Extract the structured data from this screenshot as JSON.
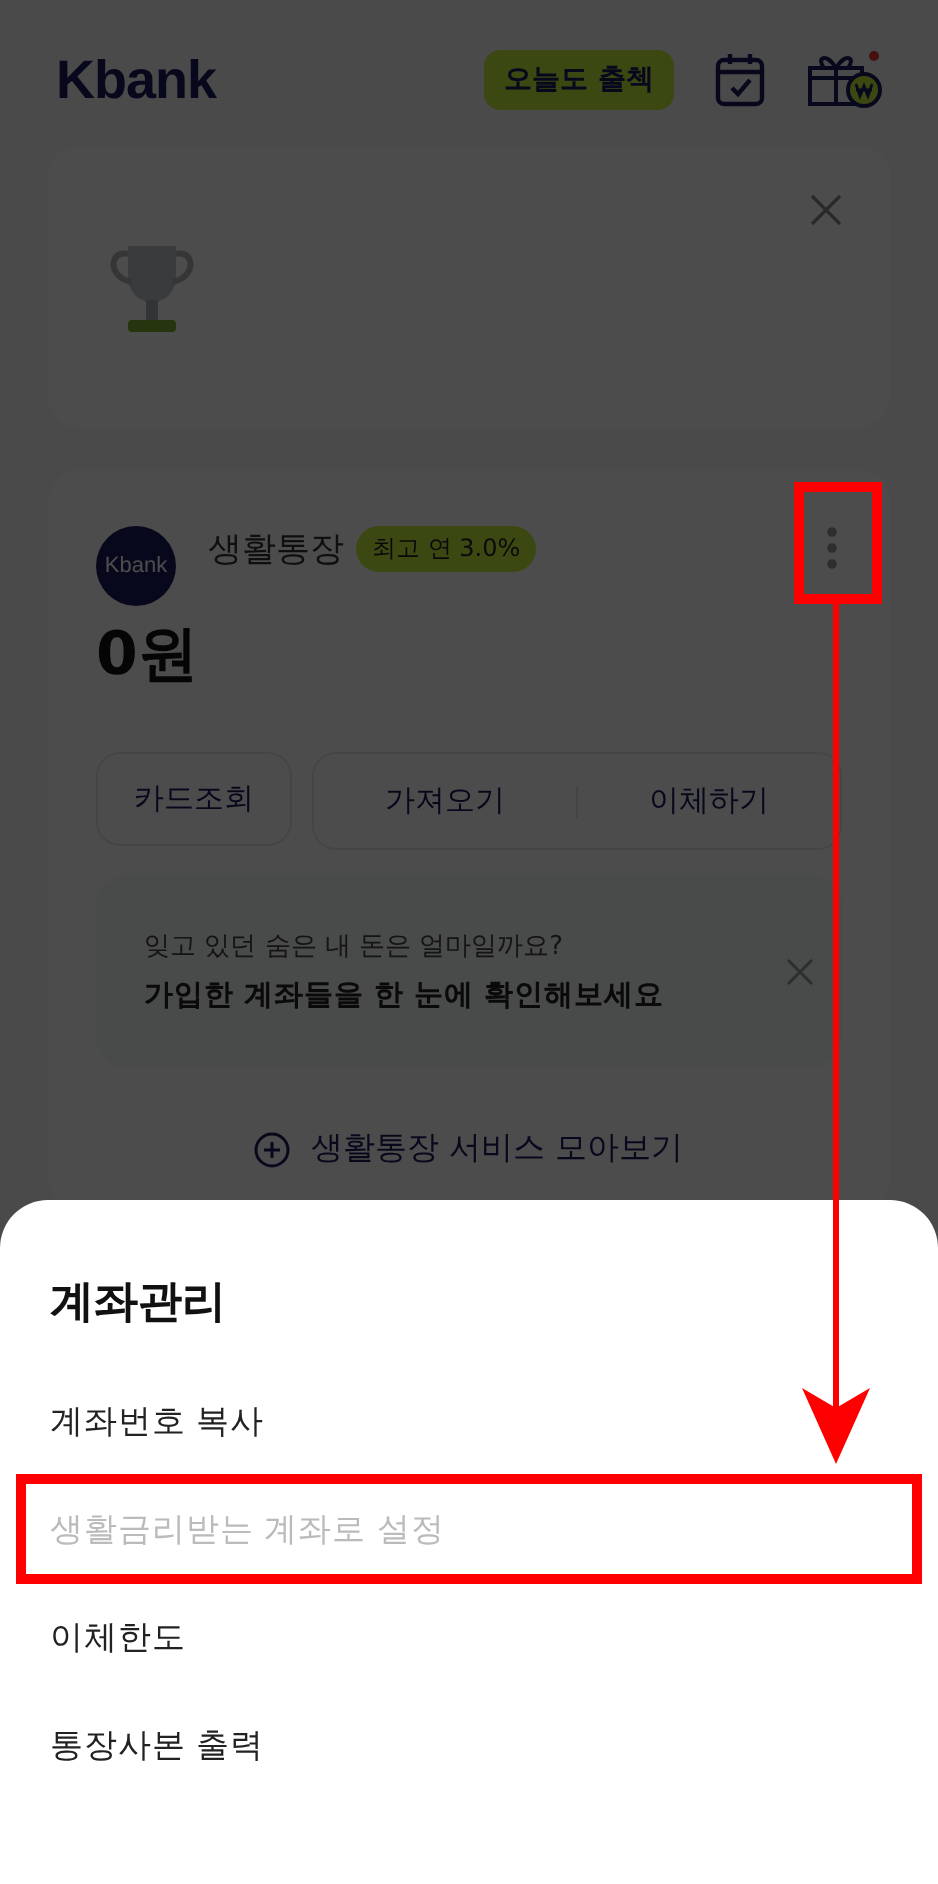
{
  "header": {
    "logo": "Kbank",
    "attendance_badge": "오늘도 출첵"
  },
  "account": {
    "logo": "Kbank",
    "name": "생활통장",
    "rate_badge": "최고 연 3.0%",
    "balance": "0원",
    "card_button": "카드조회",
    "action_group": [
      "가져오기",
      "이체하기"
    ],
    "notice": {
      "subtitle": "잊고 있던 숨은 내 돈은 얼마일까요?",
      "title": "가입한 계좌들을 한 눈에 확인해보세요"
    },
    "services_link": "생활통장 서비스 모아보기"
  },
  "sheet": {
    "title": "계좌관리",
    "items": [
      {
        "label": "계좌번호 복사",
        "disabled": false
      },
      {
        "label": "생활금리받는 계좌로 설정",
        "disabled": true
      },
      {
        "label": "이체한도",
        "disabled": false
      },
      {
        "label": "통장사본 출력",
        "disabled": false
      }
    ]
  }
}
